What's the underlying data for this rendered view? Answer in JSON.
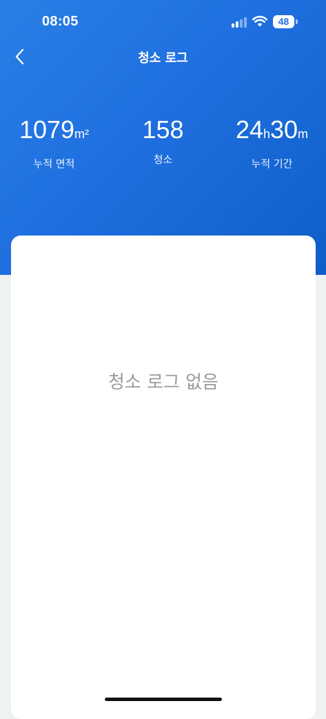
{
  "status_bar": {
    "time": "08:05",
    "battery": "48",
    "signal_icon": "cellular-signal-icon",
    "wifi_icon": "wifi-icon",
    "battery_icon": "battery-icon"
  },
  "nav": {
    "back_icon": "chevron-left-icon",
    "title": "청소 로그"
  },
  "stats": {
    "area": {
      "value": "1079",
      "unit": "m²",
      "label": "누적 면적"
    },
    "count": {
      "value": "158",
      "label": "청소"
    },
    "duration": {
      "hours": "24",
      "hours_unit": "h",
      "minutes": "30",
      "minutes_unit": "m",
      "label": "누적 기간"
    }
  },
  "content": {
    "empty_message": "청소 로그 없음"
  },
  "colors": {
    "header_gradient_start": "#2a7fe6",
    "header_gradient_end": "#0f5ec8",
    "page_background": "#eef2f3",
    "card_background": "#ffffff",
    "empty_text": "#9a9a9a"
  }
}
